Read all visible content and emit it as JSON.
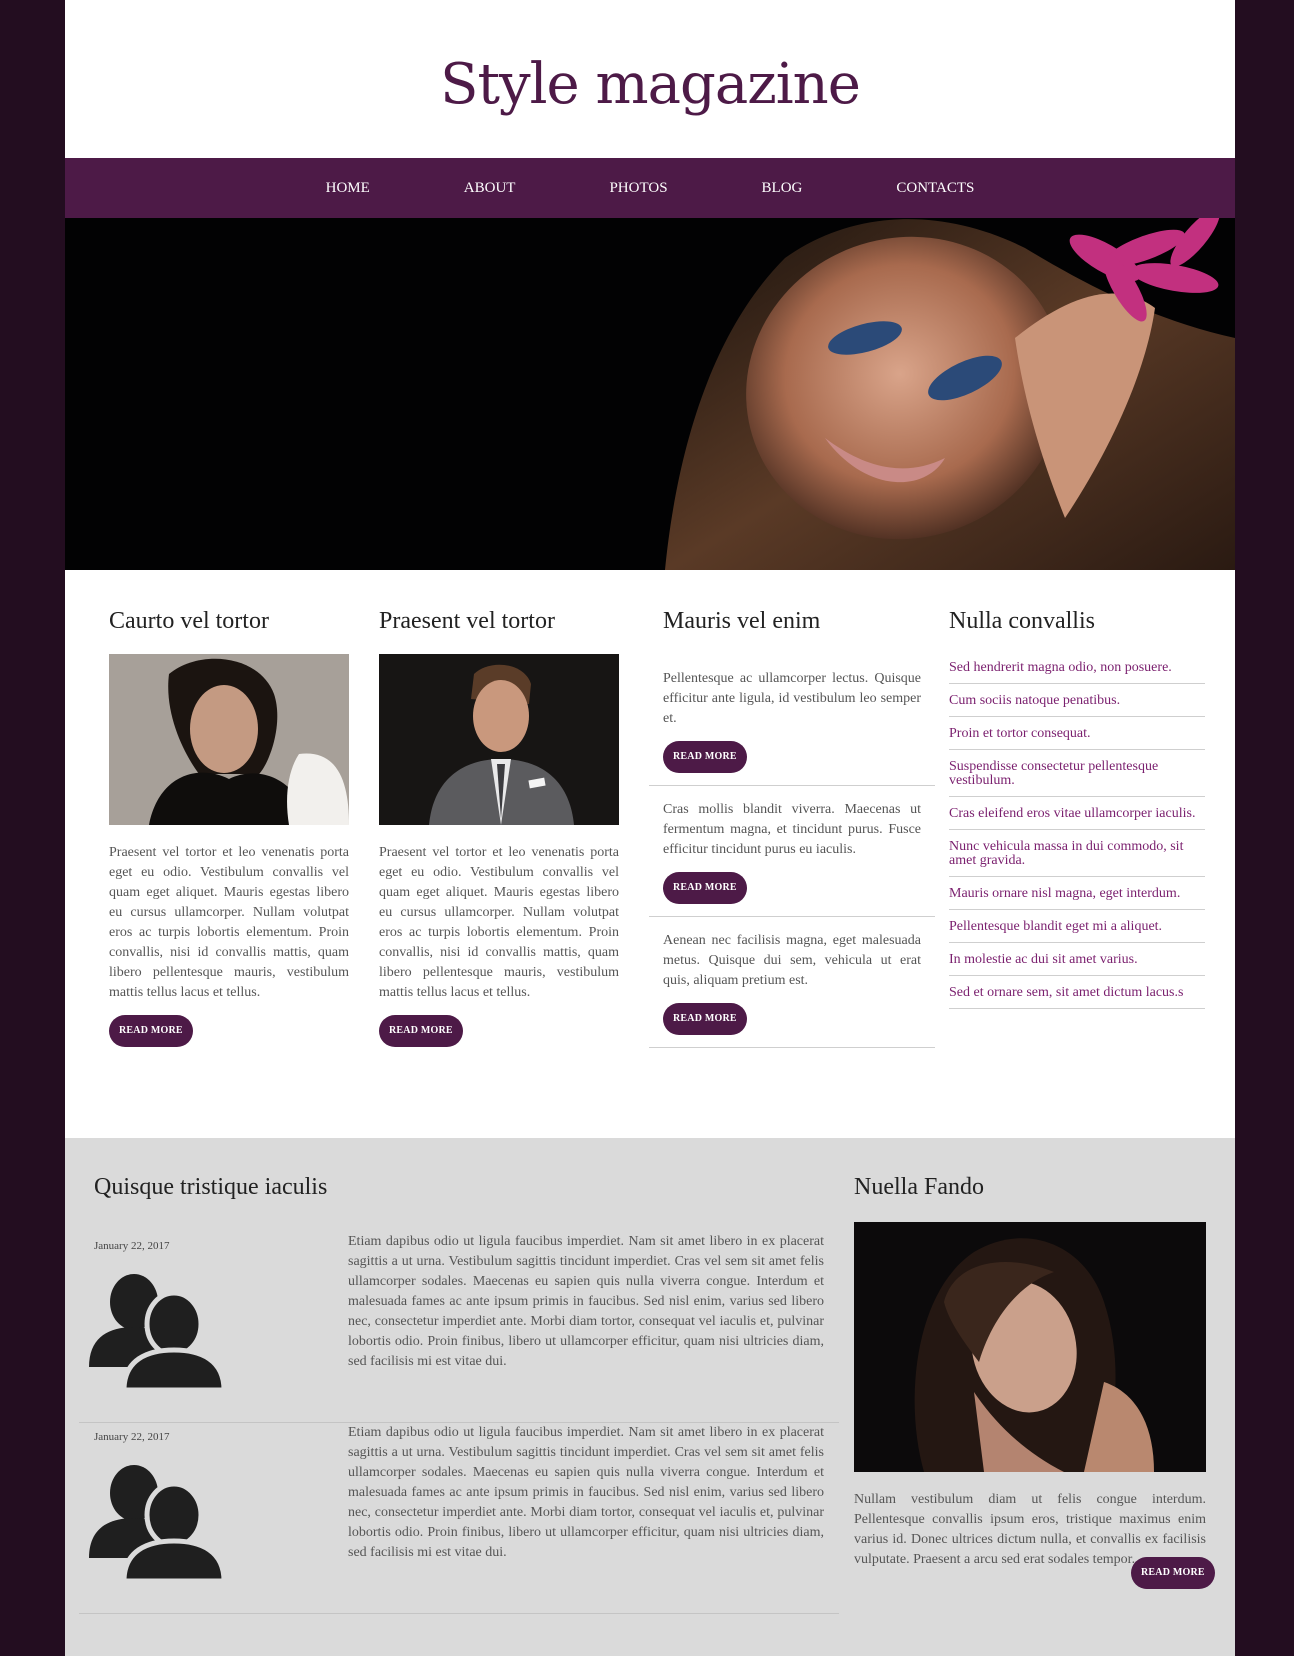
{
  "site": {
    "logo": "Style magazine"
  },
  "nav": {
    "items": [
      {
        "label": "HOME"
      },
      {
        "label": "ABOUT"
      },
      {
        "label": "PHOTOS"
      },
      {
        "label": "BLOG"
      },
      {
        "label": "CONTACTS"
      }
    ]
  },
  "features": {
    "col1": {
      "title": "Caurto vel tortor",
      "text": "Praesent vel tortor et leo venenatis porta eget eu odio. Vestibulum convallis vel quam eget aliquet. Mauris egestas libero eu cursus ullamcorper. Nullam volutpat eros ac turpis lobortis elementum. Proin convallis, nisi id convallis mattis, quam libero pellentesque mauris, vestibulum mattis tellus lacus et tellus.",
      "button": "READ MORE"
    },
    "col2": {
      "title": "Praesent vel tortor",
      "text": "Praesent vel tortor et leo venenatis porta eget eu odio. Vestibulum convallis vel quam eget aliquet. Mauris egestas libero eu cursus ullamcorper. Nullam volutpat eros ac turpis lobortis elementum. Proin convallis, nisi id convallis mattis, quam libero pellentesque mauris, vestibulum mattis tellus lacus et tellus.",
      "button": "READ MORE"
    },
    "col3": {
      "title": "Mauris vel enim",
      "items": [
        {
          "text": "Pellentesque ac ullamcorper lectus. Quisque efficitur ante ligula, id vestibulum leo semper et.",
          "button": "READ MORE"
        },
        {
          "text": "Cras mollis blandit viverra. Maecenas ut fermentum magna, et tincidunt purus. Fusce efficitur tincidunt purus eu iaculis.",
          "button": "READ MORE"
        },
        {
          "text": "Aenean nec facilisis magna, eget malesuada metus. Quisque dui sem, vehicula ut erat quis, aliquam pretium est.",
          "button": "READ MORE"
        }
      ]
    },
    "col4": {
      "title": "Nulla convallis",
      "links": [
        "Sed hendrerit magna odio, non posuere.",
        "Cum sociis natoque penatibus.",
        "Proin et tortor consequat.",
        "Suspendisse consectetur pellentesque vestibulum.",
        "Cras eleifend eros vitae ullamcorper iaculis.",
        "Nunc vehicula massa in dui commodo, sit amet gravida.",
        "Mauris ornare nisl magna, eget interdum.",
        "Pellentesque blandit eget mi a aliquet.",
        "In molestie ac dui sit amet varius.",
        "Sed et ornare sem, sit amet dictum lacus.s"
      ]
    }
  },
  "blog": {
    "title": "Quisque tristique iaculis",
    "posts": [
      {
        "date": "January 22, 2017",
        "text": "Etiam dapibus odio ut ligula faucibus imperdiet. Nam sit amet libero in ex placerat sagittis a ut urna. Vestibulum sagittis tincidunt imperdiet. Cras vel sem sit amet felis ullamcorper sodales. Maecenas eu sapien quis nulla viverra congue. Interdum et malesuada fames ac ante ipsum primis in faucibus. Sed nisl enim, varius sed libero nec, consectetur imperdiet ante. Morbi diam tortor, consequat vel iaculis et, pulvinar lobortis odio. Proin finibus, libero ut ullamcorper efficitur, quam nisi ultricies diam, sed facilisis mi est vitae dui."
      },
      {
        "date": "January 22, 2017",
        "text": "Etiam dapibus odio ut ligula faucibus imperdiet. Nam sit amet libero in ex placerat sagittis a ut urna. Vestibulum sagittis tincidunt imperdiet. Cras vel sem sit amet felis ullamcorper sodales. Maecenas eu sapien quis nulla viverra congue. Interdum et malesuada fames ac ante ipsum primis in faucibus. Sed nisl enim, varius sed libero nec, consectetur imperdiet ante. Morbi diam tortor, consequat vel iaculis et, pulvinar lobortis odio. Proin finibus, libero ut ullamcorper efficitur, quam nisi ultricies diam, sed facilisis mi est vitae dui."
      }
    ]
  },
  "profile": {
    "title": "Nuella Fando",
    "text": "Nullam vestibulum diam ut felis congue interdum. Pellentesque convallis ipsum eros, tristique maximus enim varius id. Donec ultrices dictum nulla, et convallis ex facilisis vulputate. Praesent a arcu sed erat sodales tempor.",
    "button": "READ MORE"
  },
  "colors": {
    "brand": "#4d1a47",
    "link": "#7a1f6e",
    "outer_bg": "#230d20",
    "bottom_bg": "#dadada"
  }
}
